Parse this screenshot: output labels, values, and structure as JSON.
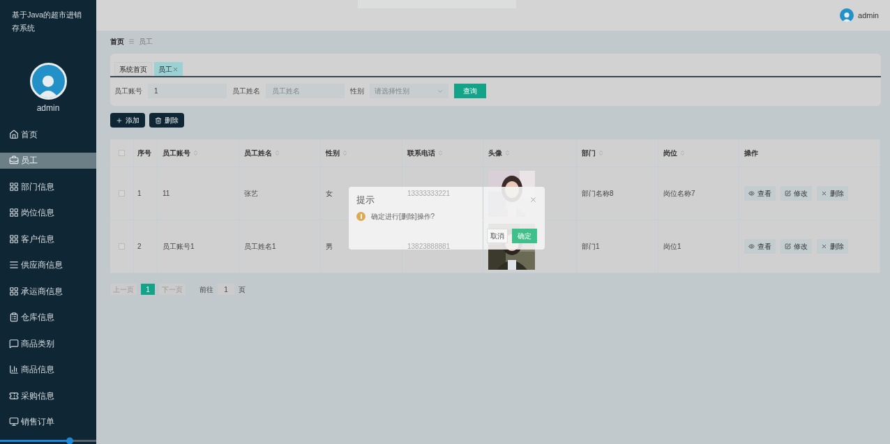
{
  "sidebar": {
    "title": "基于Java的超市进销存系统",
    "user": "admin",
    "items": [
      {
        "label": "首页",
        "selected": false
      },
      {
        "label": "员工",
        "selected": true
      },
      {
        "label": "部门信息",
        "selected": false
      },
      {
        "label": "岗位信息",
        "selected": false
      },
      {
        "label": "客户信息",
        "selected": false
      },
      {
        "label": "供应商信息",
        "selected": false
      },
      {
        "label": "承运商信息",
        "selected": false
      },
      {
        "label": "仓库信息",
        "selected": false
      },
      {
        "label": "商品类别",
        "selected": false
      },
      {
        "label": "商品信息",
        "selected": false
      },
      {
        "label": "采购信息",
        "selected": false
      },
      {
        "label": "销售订单",
        "selected": false
      }
    ]
  },
  "header": {
    "user": "admin"
  },
  "breadcrumb": [
    "首页",
    "员工"
  ],
  "tabs": [
    {
      "label": "系统首页",
      "selected": false,
      "closable": false
    },
    {
      "label": "员工",
      "selected": true,
      "closable": true
    }
  ],
  "filters": [
    {
      "label": "员工账号",
      "kind": "input",
      "value": "1"
    },
    {
      "label": "员工姓名",
      "kind": "input",
      "placeholder": "员工姓名"
    },
    {
      "label": "性别",
      "kind": "select",
      "placeholder": "请选择性别"
    }
  ],
  "search_button": "查询",
  "actions": [
    "添加",
    "删除"
  ],
  "table": {
    "all_checked": false,
    "columns": [
      "序号",
      "员工账号",
      "员工姓名",
      "性别",
      "联系电话",
      "头像",
      "部门",
      "岗位",
      "操作"
    ],
    "rows": [
      {
        "checked": false,
        "cells": [
          "1",
          "11",
          "张艺",
          "女",
          "13333333221"
        ],
        "dept": "部门名称8",
        "post": "岗位名称7",
        "actions": [
          "查看",
          "修改",
          "删除"
        ]
      },
      {
        "checked": false,
        "cells": [
          "2",
          "员工账号1",
          "员工姓名1",
          "男",
          "13823888881"
        ],
        "dept": "部门1",
        "post": "岗位1",
        "actions": [
          "查看",
          "修改",
          "删除"
        ]
      }
    ]
  },
  "pagination": {
    "prev": "上一页",
    "pages": [
      {
        "label": "1",
        "selected": true
      }
    ],
    "next": "下一页",
    "goto": "前往",
    "page": "1",
    "suffix": "页"
  },
  "dialog": {
    "title": "提示",
    "message": "确定进行[删除]操作?",
    "cancel": "取消",
    "confirm": "确定"
  }
}
